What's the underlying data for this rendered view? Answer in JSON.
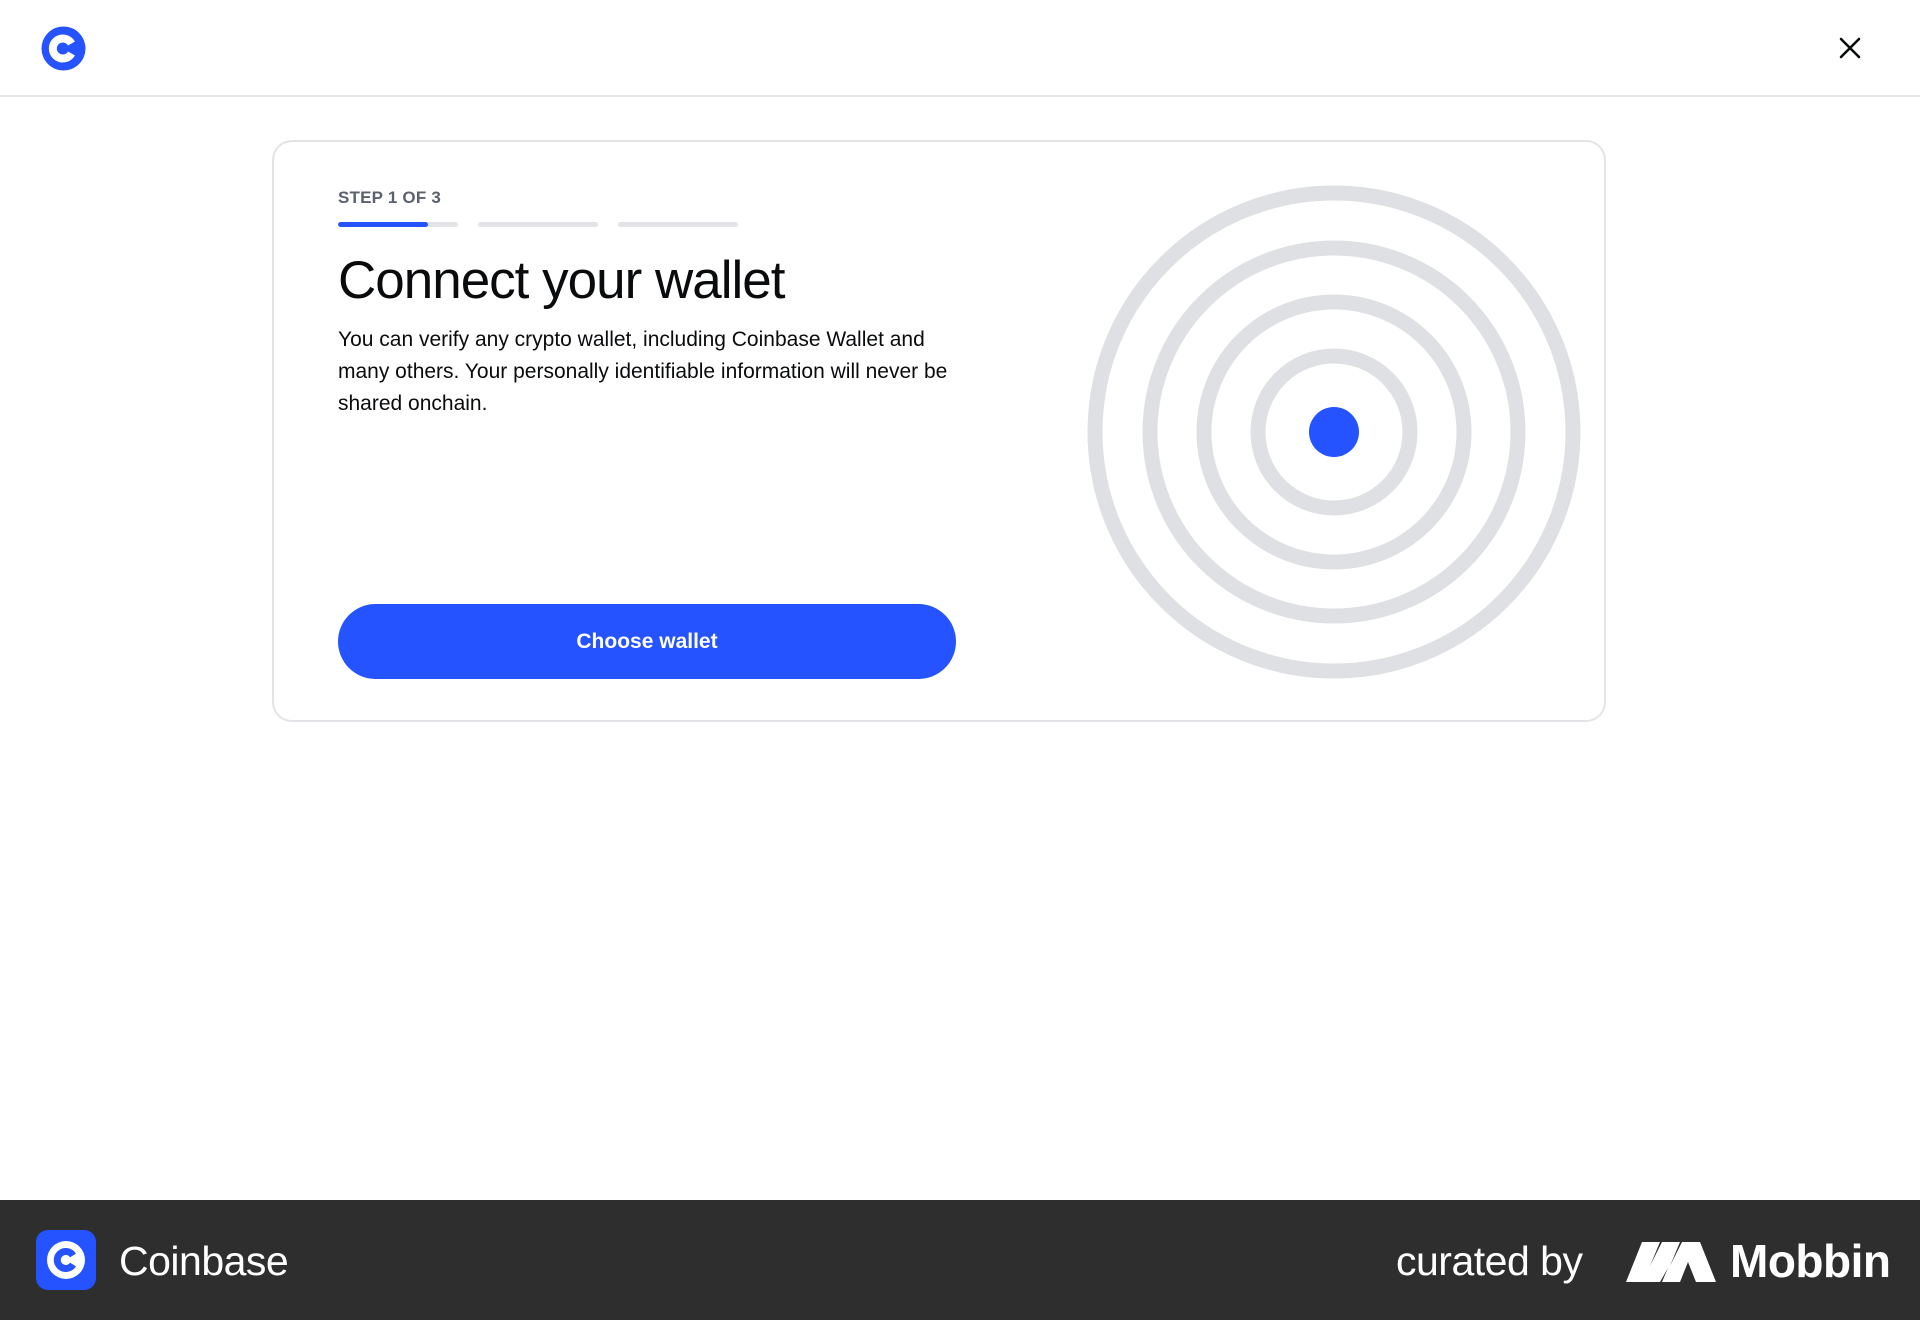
{
  "header": {
    "logo_icon": "coinbase-logo-icon",
    "close_icon": "close-icon"
  },
  "card": {
    "step_label": "STEP 1 OF 3",
    "progress": {
      "total_steps": 3,
      "current_step": 1,
      "current_step_fill": 0.75
    },
    "title": "Connect your wallet",
    "description": "You can verify any crypto wallet, including Coinbase Wallet and many others. Your personally identifiable information will never be shared onchain.",
    "primary_button": "Choose wallet",
    "illustration": "concentric-rings-illustration"
  },
  "footer": {
    "brand": "Coinbase",
    "curated_by": "curated by",
    "mobbin": "Mobbin"
  },
  "colors": {
    "accent": "#2453ff",
    "ring": "#dfe0e3",
    "footer_bg": "#2e2e2e"
  }
}
